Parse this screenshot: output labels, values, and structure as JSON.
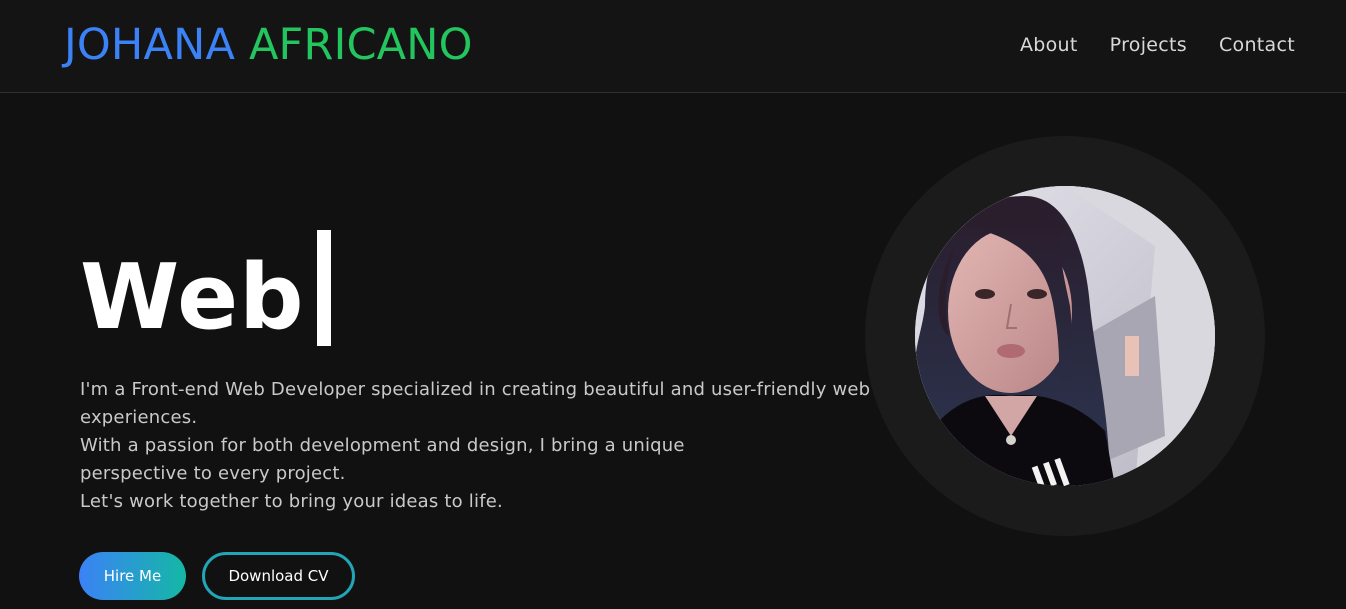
{
  "header": {
    "brand_first": "JOHANA",
    "brand_last": "AFRICANO",
    "nav": [
      {
        "label": "About"
      },
      {
        "label": "Projects"
      },
      {
        "label": "Contact"
      }
    ]
  },
  "hero": {
    "typed_word": "Web",
    "bio": [
      "I'm a Front-end Web Developer specialized in creating beautiful and user-friendly web experiences.",
      "With a passion for both development and design, I bring a unique perspective to every project.",
      "Let's work together to bring your ideas to life."
    ],
    "buttons": {
      "hire": "Hire Me",
      "cv": "Download CV"
    }
  },
  "colors": {
    "background": "#121112",
    "brand_first": "#3b82f6",
    "brand_last": "#22c55e",
    "accent_gradient_start": "#3b82f6",
    "accent_gradient_end": "#14b8a6"
  }
}
